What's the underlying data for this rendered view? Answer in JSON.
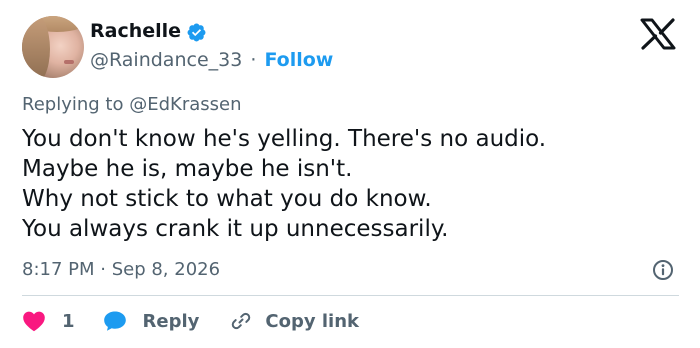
{
  "author": {
    "name": "Rachelle",
    "handle": "@Raindance_33",
    "separator": "·",
    "follow_label": "Follow"
  },
  "reply_context": {
    "prefix": "Replying to",
    "mention": "@EdKrassen"
  },
  "tweet": {
    "lines": [
      "You don't know he's yelling. There's no audio.",
      "Maybe he is, maybe he isn't.",
      "Why not stick to what you do know.",
      "You always crank it up unnecessarily."
    ],
    "timestamp": "8:17 PM · Sep 8, 2026"
  },
  "actions": {
    "like_count": "1",
    "reply_label": "Reply",
    "copy_label": "Copy link"
  },
  "colors": {
    "accent": "#1d9bf0",
    "like": "#f91880",
    "muted": "#536471",
    "text": "#0f1419"
  },
  "icons": [
    "verified-badge-icon",
    "x-logo-icon",
    "info-icon",
    "heart-icon",
    "reply-bubble-icon",
    "link-icon"
  ]
}
